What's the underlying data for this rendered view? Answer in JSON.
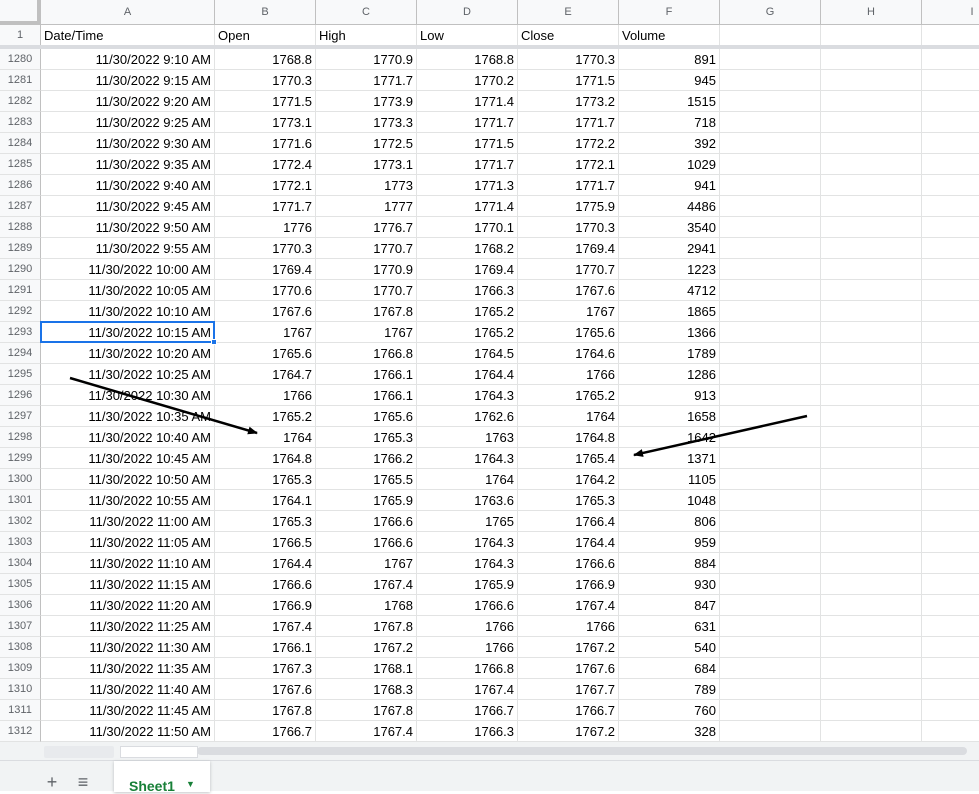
{
  "sheet": {
    "columns": [
      "A",
      "B",
      "C",
      "D",
      "E",
      "F",
      "G",
      "H",
      "I"
    ],
    "header_row_number": "1",
    "headers": [
      "Date/Time",
      "Open",
      "High",
      "Low",
      "Close",
      "Volume"
    ],
    "rows": [
      {
        "n": "1280",
        "dt": "11/30/2022 9:10 AM",
        "open": "1768.8",
        "high": "1770.9",
        "low": "1768.8",
        "close": "1770.3",
        "vol": "891"
      },
      {
        "n": "1281",
        "dt": "11/30/2022 9:15 AM",
        "open": "1770.3",
        "high": "1771.7",
        "low": "1770.2",
        "close": "1771.5",
        "vol": "945"
      },
      {
        "n": "1282",
        "dt": "11/30/2022 9:20 AM",
        "open": "1771.5",
        "high": "1773.9",
        "low": "1771.4",
        "close": "1773.2",
        "vol": "1515"
      },
      {
        "n": "1283",
        "dt": "11/30/2022 9:25 AM",
        "open": "1773.1",
        "high": "1773.3",
        "low": "1771.7",
        "close": "1771.7",
        "vol": "718"
      },
      {
        "n": "1284",
        "dt": "11/30/2022 9:30 AM",
        "open": "1771.6",
        "high": "1772.5",
        "low": "1771.5",
        "close": "1772.2",
        "vol": "392"
      },
      {
        "n": "1285",
        "dt": "11/30/2022 9:35 AM",
        "open": "1772.4",
        "high": "1773.1",
        "low": "1771.7",
        "close": "1772.1",
        "vol": "1029"
      },
      {
        "n": "1286",
        "dt": "11/30/2022 9:40 AM",
        "open": "1772.1",
        "high": "1773",
        "low": "1771.3",
        "close": "1771.7",
        "vol": "941"
      },
      {
        "n": "1287",
        "dt": "11/30/2022 9:45 AM",
        "open": "1771.7",
        "high": "1777",
        "low": "1771.4",
        "close": "1775.9",
        "vol": "4486"
      },
      {
        "n": "1288",
        "dt": "11/30/2022 9:50 AM",
        "open": "1776",
        "high": "1776.7",
        "low": "1770.1",
        "close": "1770.3",
        "vol": "3540"
      },
      {
        "n": "1289",
        "dt": "11/30/2022 9:55 AM",
        "open": "1770.3",
        "high": "1770.7",
        "low": "1768.2",
        "close": "1769.4",
        "vol": "2941"
      },
      {
        "n": "1290",
        "dt": "11/30/2022 10:00 AM",
        "open": "1769.4",
        "high": "1770.9",
        "low": "1769.4",
        "close": "1770.7",
        "vol": "1223"
      },
      {
        "n": "1291",
        "dt": "11/30/2022 10:05 AM",
        "open": "1770.6",
        "high": "1770.7",
        "low": "1766.3",
        "close": "1767.6",
        "vol": "4712"
      },
      {
        "n": "1292",
        "dt": "11/30/2022 10:10 AM",
        "open": "1767.6",
        "high": "1767.8",
        "low": "1765.2",
        "close": "1767",
        "vol": "1865"
      },
      {
        "n": "1293",
        "dt": "11/30/2022 10:15 AM",
        "open": "1767",
        "high": "1767",
        "low": "1765.2",
        "close": "1765.6",
        "vol": "1366"
      },
      {
        "n": "1294",
        "dt": "11/30/2022 10:20 AM",
        "open": "1765.6",
        "high": "1766.8",
        "low": "1764.5",
        "close": "1764.6",
        "vol": "1789"
      },
      {
        "n": "1295",
        "dt": "11/30/2022 10:25 AM",
        "open": "1764.7",
        "high": "1766.1",
        "low": "1764.4",
        "close": "1766",
        "vol": "1286"
      },
      {
        "n": "1296",
        "dt": "11/30/2022 10:30 AM",
        "open": "1766",
        "high": "1766.1",
        "low": "1764.3",
        "close": "1765.2",
        "vol": "913"
      },
      {
        "n": "1297",
        "dt": "11/30/2022 10:35 AM",
        "open": "1765.2",
        "high": "1765.6",
        "low": "1762.6",
        "close": "1764",
        "vol": "1658"
      },
      {
        "n": "1298",
        "dt": "11/30/2022 10:40 AM",
        "open": "1764",
        "high": "1765.3",
        "low": "1763",
        "close": "1764.8",
        "vol": "1642"
      },
      {
        "n": "1299",
        "dt": "11/30/2022 10:45 AM",
        "open": "1764.8",
        "high": "1766.2",
        "low": "1764.3",
        "close": "1765.4",
        "vol": "1371"
      },
      {
        "n": "1300",
        "dt": "11/30/2022 10:50 AM",
        "open": "1765.3",
        "high": "1765.5",
        "low": "1764",
        "close": "1764.2",
        "vol": "1105"
      },
      {
        "n": "1301",
        "dt": "11/30/2022 10:55 AM",
        "open": "1764.1",
        "high": "1765.9",
        "low": "1763.6",
        "close": "1765.3",
        "vol": "1048"
      },
      {
        "n": "1302",
        "dt": "11/30/2022 11:00 AM",
        "open": "1765.3",
        "high": "1766.6",
        "low": "1765",
        "close": "1766.4",
        "vol": "806"
      },
      {
        "n": "1303",
        "dt": "11/30/2022 11:05 AM",
        "open": "1766.5",
        "high": "1766.6",
        "low": "1764.3",
        "close": "1764.4",
        "vol": "959"
      },
      {
        "n": "1304",
        "dt": "11/30/2022 11:10 AM",
        "open": "1764.4",
        "high": "1767",
        "low": "1764.3",
        "close": "1766.6",
        "vol": "884"
      },
      {
        "n": "1305",
        "dt": "11/30/2022 11:15 AM",
        "open": "1766.6",
        "high": "1767.4",
        "low": "1765.9",
        "close": "1766.9",
        "vol": "930"
      },
      {
        "n": "1306",
        "dt": "11/30/2022 11:20 AM",
        "open": "1766.9",
        "high": "1768",
        "low": "1766.6",
        "close": "1767.4",
        "vol": "847"
      },
      {
        "n": "1307",
        "dt": "11/30/2022 11:25 AM",
        "open": "1767.4",
        "high": "1767.8",
        "low": "1766",
        "close": "1766",
        "vol": "631"
      },
      {
        "n": "1308",
        "dt": "11/30/2022 11:30 AM",
        "open": "1766.1",
        "high": "1767.2",
        "low": "1766",
        "close": "1767.2",
        "vol": "540"
      },
      {
        "n": "1309",
        "dt": "11/30/2022 11:35 AM",
        "open": "1767.3",
        "high": "1768.1",
        "low": "1766.8",
        "close": "1767.6",
        "vol": "684"
      },
      {
        "n": "1310",
        "dt": "11/30/2022 11:40 AM",
        "open": "1767.6",
        "high": "1768.3",
        "low": "1767.4",
        "close": "1767.7",
        "vol": "789"
      },
      {
        "n": "1311",
        "dt": "11/30/2022 11:45 AM",
        "open": "1767.8",
        "high": "1767.8",
        "low": "1766.7",
        "close": "1766.7",
        "vol": "760"
      },
      {
        "n": "1312",
        "dt": "11/30/2022 11:50 AM",
        "open": "1766.7",
        "high": "1767.4",
        "low": "1766.3",
        "close": "1767.2",
        "vol": "328"
      }
    ],
    "selected_row": "1293",
    "selected_column": "A"
  },
  "annotations": {
    "arrow_color": "#000000",
    "arrows": [
      "arrow-pointing-open-1298",
      "arrow-pointing-close-1299"
    ]
  },
  "tabs": {
    "add_icon": "plus-icon",
    "list_icon": "sheet-list-icon",
    "sheet_name": "Sheet1",
    "accent": "#188038"
  },
  "colors": {
    "selection": "#1a73e8",
    "header_bg": "#f8f9fa",
    "gridline": "#e2e3e3"
  }
}
